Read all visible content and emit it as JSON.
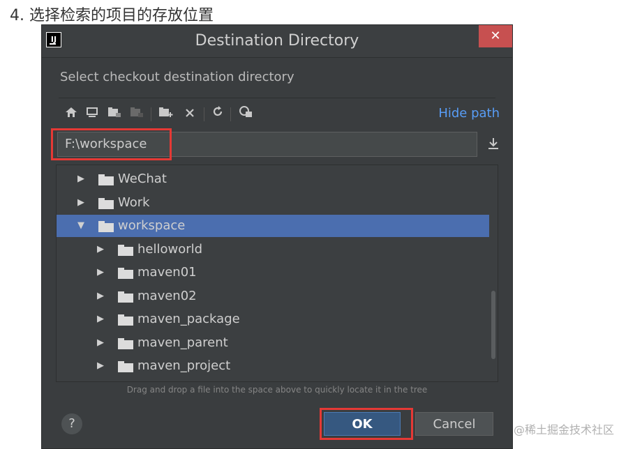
{
  "heading": "4. 选择检索的项目的存放位置",
  "dialog": {
    "title": "Destination Directory",
    "close_glyph": "✕",
    "app_logo": "IJ",
    "subtitle": "Select checkout destination directory",
    "hide_path": "Hide path",
    "path_value": "F:\\workspace",
    "hint": "Drag and drop a file into the space above to quickly locate it in the tree",
    "ok_label": "OK",
    "cancel_label": "Cancel",
    "help_glyph": "?"
  },
  "tree": [
    {
      "name": "WeChat",
      "depth": 1,
      "expanded": false,
      "selected": false
    },
    {
      "name": "Work",
      "depth": 1,
      "expanded": false,
      "selected": false
    },
    {
      "name": "workspace",
      "depth": 1,
      "expanded": true,
      "selected": true
    },
    {
      "name": "helloworld",
      "depth": 2,
      "expanded": false,
      "selected": false
    },
    {
      "name": "maven01",
      "depth": 2,
      "expanded": false,
      "selected": false
    },
    {
      "name": "maven02",
      "depth": 2,
      "expanded": false,
      "selected": false
    },
    {
      "name": "maven_package",
      "depth": 2,
      "expanded": false,
      "selected": false
    },
    {
      "name": "maven_parent",
      "depth": 2,
      "expanded": false,
      "selected": false
    },
    {
      "name": "maven_project",
      "depth": 2,
      "expanded": false,
      "selected": false
    }
  ],
  "watermark": "@稀土掘金技术社区",
  "colors": {
    "selection": "#4b6eaf",
    "link": "#589df6",
    "close": "#c75050",
    "highlight": "#e53935"
  }
}
